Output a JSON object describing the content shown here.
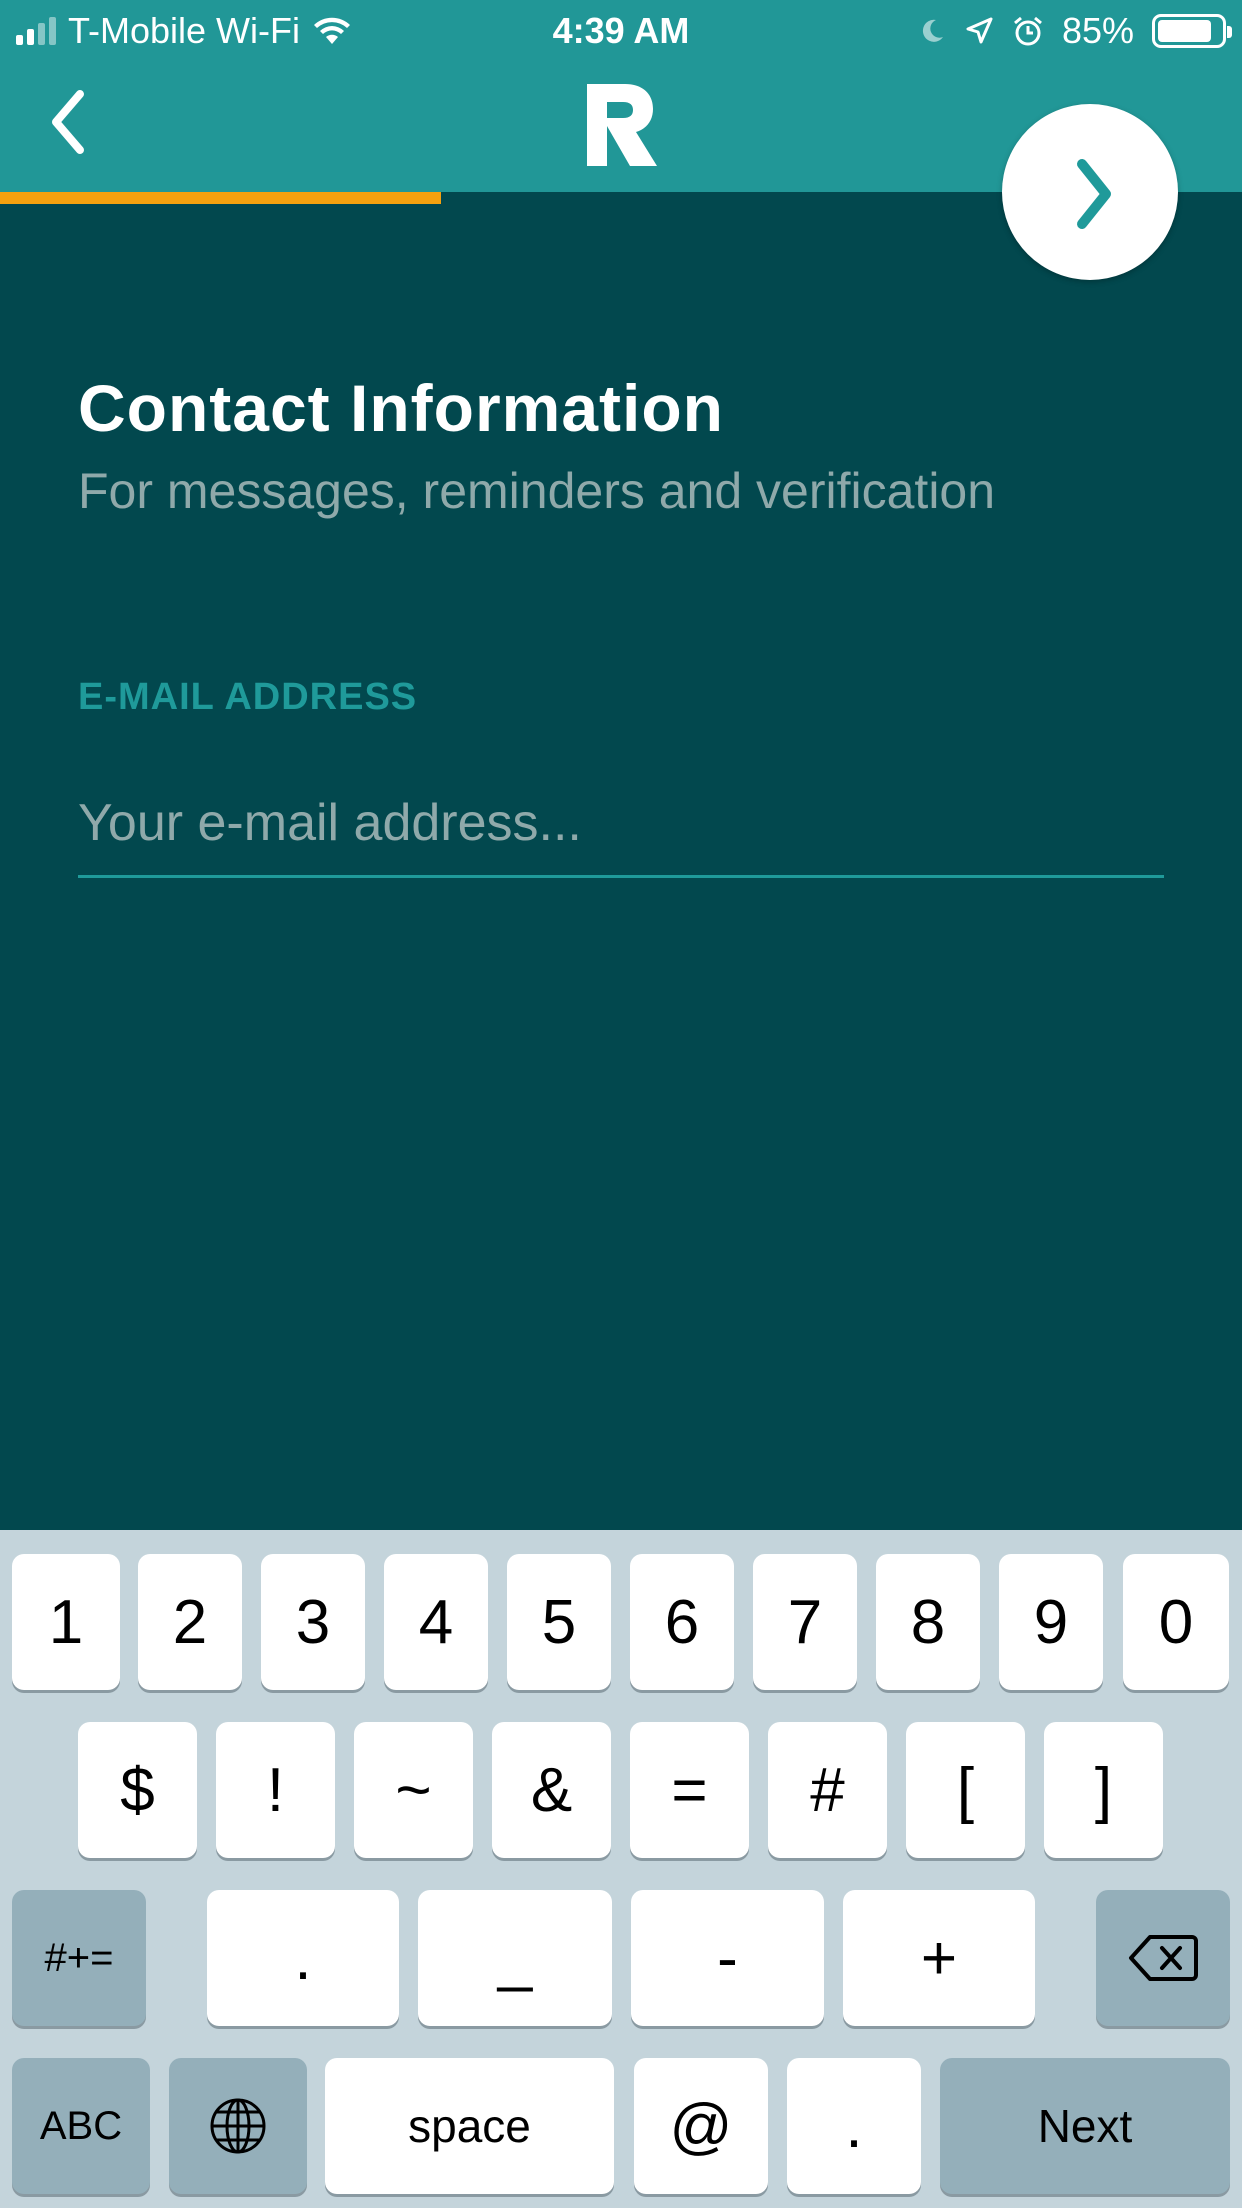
{
  "status_bar": {
    "carrier": "T-Mobile Wi-Fi",
    "time": "4:39 AM",
    "battery": "85%",
    "battery_level": 0.85
  },
  "header": {
    "logo_text": "R",
    "progress_fraction": 0.355,
    "accent_color": "#f5a10f",
    "brand_color": "#219797"
  },
  "form": {
    "title": "Contact Information",
    "subtitle": "For messages, reminders and verification",
    "email_label": "E-MAIL ADDRESS",
    "email_placeholder": "Your e-mail address...",
    "email_value": ""
  },
  "keyboard": {
    "row1": [
      "1",
      "2",
      "3",
      "4",
      "5",
      "6",
      "7",
      "8",
      "9",
      "0"
    ],
    "row2": [
      "$",
      "!",
      "~",
      "&",
      "=",
      "#",
      "[",
      "]"
    ],
    "row3": {
      "symbols_toggle": "#+=",
      "keys": [
        ".",
        "_",
        "-",
        "+"
      ],
      "delete_icon": "backspace-icon"
    },
    "row4": {
      "abc": "ABC",
      "globe_icon": "globe-icon",
      "space": "space",
      "at": "@",
      "dot": ".",
      "next": "Next"
    }
  }
}
